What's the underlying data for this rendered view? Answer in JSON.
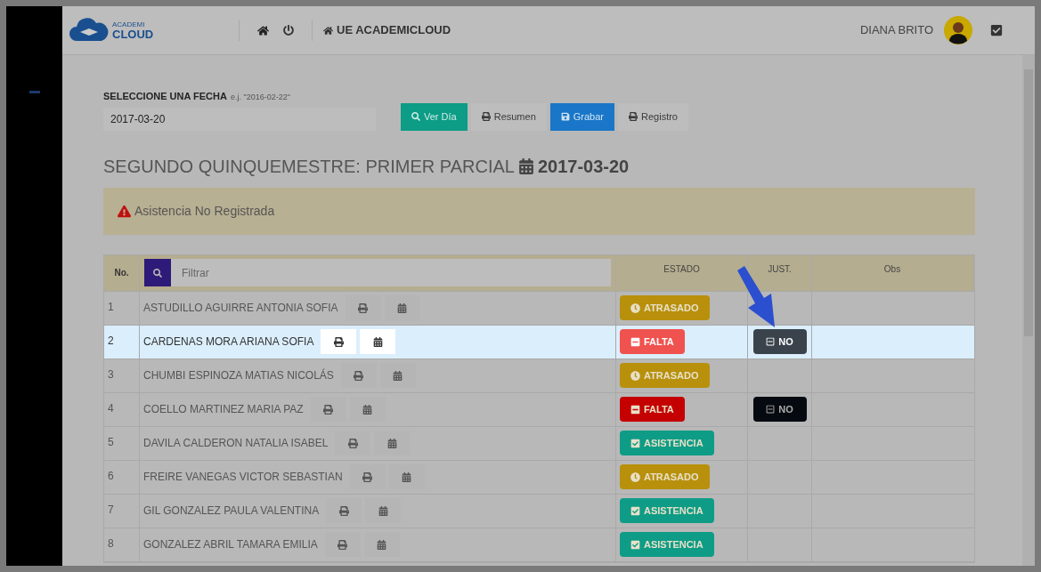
{
  "header": {
    "logo_top": "ACADEMI",
    "logo_bottom": "CLOUD",
    "school": "UE ACADEMICLOUD",
    "user": "DIANA BRITO"
  },
  "date_picker": {
    "label": "SELECCIONE UNA FECHA",
    "hint": "e.j. \"2016-02-22\"",
    "value": "2017-03-20"
  },
  "buttons": [
    {
      "label": "Ver Día",
      "kind": "view"
    },
    {
      "label": "Resumen",
      "kind": "print"
    },
    {
      "label": "Grabar",
      "kind": "save"
    },
    {
      "label": "Registro",
      "kind": "print"
    }
  ],
  "heading": {
    "title": "SEGUNDO QUINQUEMESTRE: PRIMER PARCIAL",
    "date": "2017-03-20"
  },
  "alert": "Asistencia No Registrada",
  "table": {
    "columns": [
      "No.",
      "ESTADO",
      "JUST.",
      "Obs"
    ],
    "filter_placeholder": "Filtrar",
    "rows": [
      {
        "number": "1",
        "name": "ASTUDILLO AGUIRRE ANTONIA SOFIA",
        "status": {
          "kind": "late",
          "label": "ATRASADO"
        },
        "highlighted": false
      },
      {
        "number": "2",
        "name": "CARDENAS MORA ARIANA SOFIA",
        "status": {
          "kind": "absent",
          "label": "FALTA"
        },
        "just": "NO",
        "highlighted": true
      },
      {
        "number": "3",
        "name": "CHUMBI ESPINOZA MATIAS NICOLÁS",
        "status": {
          "kind": "late",
          "label": "ATRASADO"
        },
        "highlighted": false
      },
      {
        "number": "4",
        "name": "COELLO MARTINEZ MARIA PAZ",
        "status": {
          "kind": "absent",
          "label": "FALTA"
        },
        "just": "NO",
        "highlighted": false
      },
      {
        "number": "5",
        "name": "DAVILA CALDERON NATALIA ISABEL",
        "status": {
          "kind": "present",
          "label": "ASISTENCIA"
        },
        "highlighted": false
      },
      {
        "number": "6",
        "name": "FREIRE VANEGAS VICTOR SEBASTIAN",
        "status": {
          "kind": "late",
          "label": "ATRASADO"
        },
        "highlighted": false
      },
      {
        "number": "7",
        "name": "GIL GONZALEZ PAULA VALENTINA",
        "status": {
          "kind": "present",
          "label": "ASISTENCIA"
        },
        "highlighted": false
      },
      {
        "number": "8",
        "name": "GONZALEZ ABRIL TAMARA EMILIA",
        "status": {
          "kind": "present",
          "label": "ASISTENCIA"
        },
        "highlighted": false
      }
    ]
  }
}
